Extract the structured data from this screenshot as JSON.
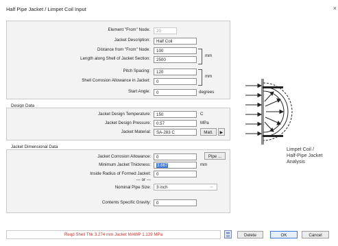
{
  "window": {
    "title": "Half Pipe Jacket / Limpet Coil Input",
    "close_label": "×"
  },
  "general": {
    "from_node": {
      "label": "Element \"From\" Node:",
      "value": "20"
    },
    "description": {
      "label": "Jacket Description:",
      "value": "Half Coil"
    },
    "distance": {
      "label": "Distance from \"From\" Node:",
      "value": "100"
    },
    "length": {
      "label": "Length along Shell of Jacket Section:",
      "value": "2500"
    },
    "length_unit": "mm",
    "pitch": {
      "label": "Pitch Spacing:",
      "value": "120"
    },
    "corrosion": {
      "label": "Shell Corrosion Allowance in Jacket:",
      "value": "0"
    },
    "pitch_unit": "mm",
    "start_angle": {
      "label": "Start Angle:",
      "value": "0",
      "unit": "degrees"
    }
  },
  "design": {
    "title": "Design Data",
    "temperature": {
      "label": "Jacket Design Temperature:",
      "value": "150",
      "unit": "C"
    },
    "pressure": {
      "label": "Jacket Design Pressure:",
      "value": "0.57",
      "unit": "MPa"
    },
    "material": {
      "label": "Jacket Material:",
      "value": "SA-283 C",
      "button": "Matl.",
      "arrow": "▶"
    }
  },
  "dimensional": {
    "title": "Jacket Dimensional Data",
    "corrosion": {
      "label": "Jacket Corrosion Allowance:",
      "value": "0"
    },
    "pipe_button": "Pipe ...",
    "min_thickness": {
      "label": "Minimum Jacket Thickness:",
      "value": "3.667",
      "unit": "mm"
    },
    "inside_radius": {
      "label": "Inside Radius of Formed  Jacket:",
      "value": "0"
    },
    "or": "--- or ---",
    "pipe_size": {
      "label": "Nominal Pipe Size:",
      "value": "3 inch",
      "chevron": "⌵"
    },
    "gravity": {
      "label": "Contents Specific Gravity:",
      "value": "0"
    }
  },
  "diagram": {
    "caption_lines": [
      "Limpet Coil /",
      "Half-Pipe Jacket",
      "Analysis"
    ]
  },
  "footer": {
    "status": "Reqd Shell Thk 3.274 mm   Jacket MAWP 1.129 MPa",
    "delete": "Delete",
    "ok": "OK",
    "cancel": "Cancel"
  },
  "colors": {
    "status_text": "#d4302b",
    "ok_border": "#3b78d8"
  }
}
